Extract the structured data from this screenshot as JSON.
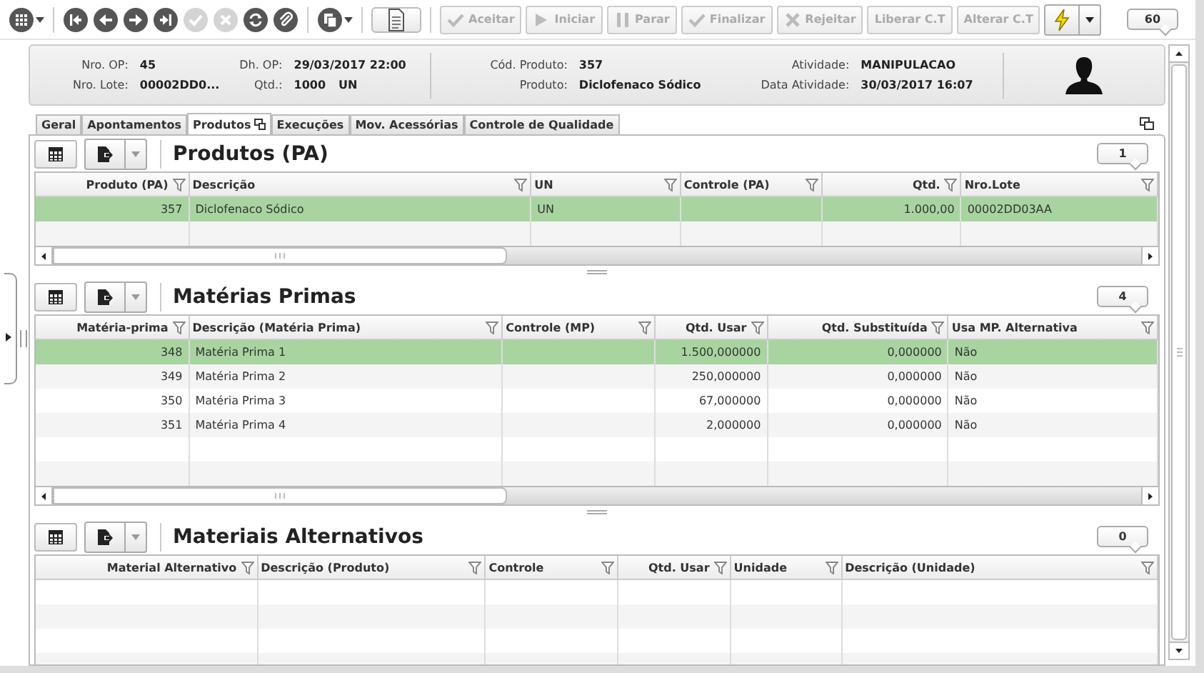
{
  "toolbar": {
    "icon_buttons": [
      {
        "kind": "grid-menu",
        "dropdown": true,
        "disabled": false
      },
      {
        "kind": "first",
        "dropdown": false,
        "disabled": false
      },
      {
        "kind": "prev",
        "dropdown": false,
        "disabled": false
      },
      {
        "kind": "next",
        "dropdown": false,
        "disabled": false
      },
      {
        "kind": "last",
        "dropdown": false,
        "disabled": false
      },
      {
        "kind": "confirm",
        "dropdown": false,
        "disabled": true
      },
      {
        "kind": "cancel",
        "dropdown": false,
        "disabled": true
      },
      {
        "kind": "refresh",
        "dropdown": false,
        "disabled": false
      },
      {
        "kind": "link",
        "dropdown": false,
        "disabled": false
      },
      {
        "kind": "copy",
        "dropdown": true,
        "disabled": false
      },
      {
        "kind": "document",
        "dropdown": false,
        "disabled": false
      }
    ],
    "action_buttons": [
      {
        "label": "Aceitar",
        "disabled": true
      },
      {
        "label": "Iniciar",
        "disabled": true
      },
      {
        "label": "Parar",
        "disabled": true
      },
      {
        "label": "Finalizar",
        "disabled": true
      },
      {
        "label": "Rejeitar",
        "disabled": true
      },
      {
        "label": "Liberar C.T",
        "disabled": true
      },
      {
        "label": "Alterar C.T",
        "disabled": true
      }
    ],
    "lightning_button": {
      "dropdown": true
    },
    "counter": "60"
  },
  "header": {
    "sections": [
      {
        "columns": [
          [
            {
              "label": "Nro. OP:",
              "value": "45"
            },
            {
              "label": "Nro. Lote:",
              "value": "00002DD0..."
            }
          ],
          [
            {
              "label": "Dh. OP:",
              "value": "29/03/2017 22:00"
            },
            {
              "label": "Qtd.:",
              "value": "1000",
              "unit": "UN"
            }
          ]
        ]
      },
      {
        "columns": [
          [
            {
              "label": "Cód. Produto:",
              "value": "357"
            },
            {
              "label": "Produto:",
              "value": "Diclofenaco Sódico"
            }
          ],
          [
            {
              "label": "Atividade:",
              "value": "MANIPULACAO"
            },
            {
              "label": "Data Atividade:",
              "value": "30/03/2017 16:07"
            }
          ]
        ]
      }
    ]
  },
  "tabs": [
    {
      "label": "Geral",
      "selected": false
    },
    {
      "label": "Apontamentos",
      "selected": false
    },
    {
      "label": "Produtos",
      "selected": true
    },
    {
      "label": "Execuções",
      "selected": false
    },
    {
      "label": "Mov. Acessórias",
      "selected": false
    },
    {
      "label": "Controle de Qualidade",
      "selected": false
    }
  ],
  "panels": [
    {
      "title": "Produtos (PA)",
      "count": "1",
      "scrollbar": true,
      "columns": [
        {
          "label": "Produto (PA)",
          "numeric": true
        },
        {
          "label": "Descrição",
          "numeric": false
        },
        {
          "label": "UN",
          "numeric": false
        },
        {
          "label": "Controle (PA)",
          "numeric": false
        },
        {
          "label": "Qtd.",
          "numeric": true
        },
        {
          "label": "Nro.Lote",
          "numeric": false
        }
      ],
      "rows": [
        {
          "cells": [
            "357",
            "Diclofenaco Sódico",
            "UN",
            null,
            "1.000,00",
            "00002DD03AA"
          ],
          "selected": true
        }
      ]
    },
    {
      "title": "Matérias Primas",
      "count": "4",
      "scrollbar": true,
      "columns": [
        {
          "label": "Matéria-prima",
          "numeric": true
        },
        {
          "label": "Descrição (Matéria Prima)",
          "numeric": false
        },
        {
          "label": "Controle (MP)",
          "numeric": false
        },
        {
          "label": "Qtd. Usar",
          "numeric": true
        },
        {
          "label": "Qtd. Substituída",
          "numeric": true
        },
        {
          "label": "Usa MP. Alternativa",
          "numeric": false
        }
      ],
      "rows": [
        {
          "cells": [
            "348",
            "Matéria Prima 1",
            null,
            "1.500,000000",
            "0,000000",
            "Não"
          ],
          "selected": true
        },
        {
          "cells": [
            "349",
            "Matéria Prima 2",
            null,
            "250,000000",
            "0,000000",
            "Não"
          ],
          "selected": false
        },
        {
          "cells": [
            "350",
            "Matéria Prima 3",
            null,
            "67,000000",
            "0,000000",
            "Não"
          ],
          "selected": false
        },
        {
          "cells": [
            "351",
            "Matéria Prima 4",
            null,
            "2,000000",
            "0,000000",
            "Não"
          ],
          "selected": false
        }
      ]
    },
    {
      "title": "Materiais Alternativos",
      "count": "0",
      "scrollbar": false,
      "columns": [
        {
          "label": "Material Alternativo",
          "numeric": true
        },
        {
          "label": "Descrição (Produto)",
          "numeric": false
        },
        {
          "label": "Controle",
          "numeric": false
        },
        {
          "label": "Qtd. Usar",
          "numeric": true
        },
        {
          "label": "Unidade",
          "numeric": false
        },
        {
          "label": "Descrição (Unidade)",
          "numeric": false
        }
      ]
    }
  ]
}
